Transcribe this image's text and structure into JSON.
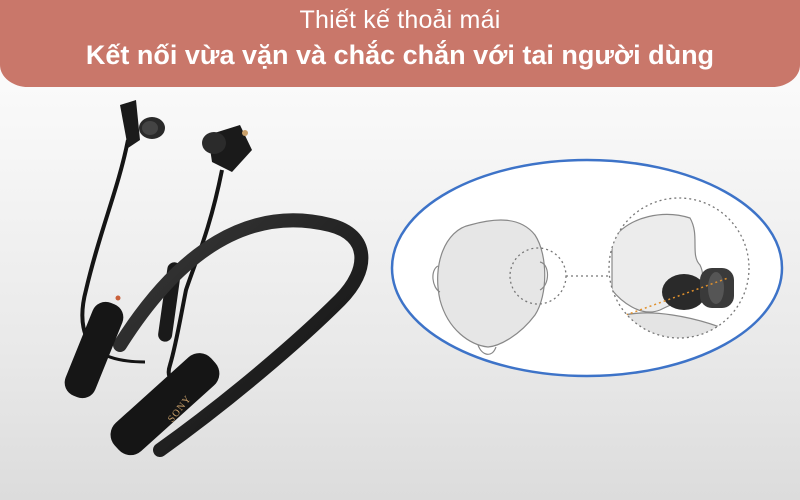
{
  "banner": {
    "line1": "Thiết kế thoải mái",
    "line2": "Kết nối vừa vặn và chắc chắn với tai người dùng"
  },
  "product": {
    "brand": "SONY"
  },
  "icons": {
    "product_image": "neckband-earphones-image",
    "fit_diagram": "ear-fit-diagram"
  },
  "colors": {
    "banner": "#c9776a",
    "ellipse_stroke": "#3d73c8"
  }
}
